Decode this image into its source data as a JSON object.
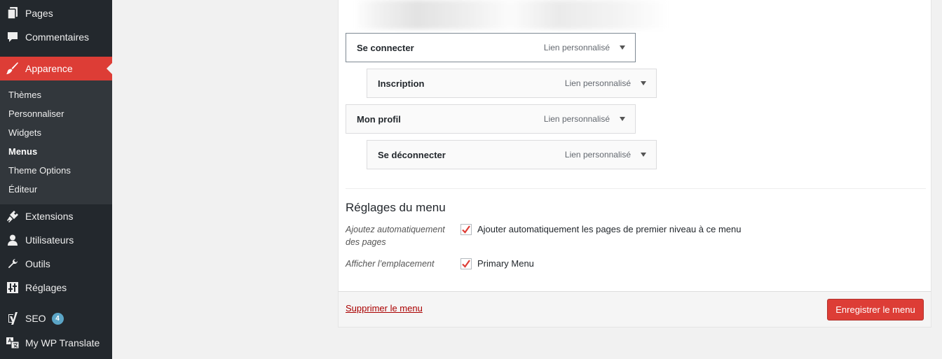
{
  "sidebar": {
    "top_items": [
      {
        "label": "Pages",
        "icon": "pages-icon"
      },
      {
        "label": "Commentaires",
        "icon": "comments-icon"
      },
      {
        "label": "Apparence",
        "icon": "paintbrush-icon",
        "active": true
      }
    ],
    "submenu": [
      {
        "label": "Thèmes"
      },
      {
        "label": "Personnaliser"
      },
      {
        "label": "Widgets"
      },
      {
        "label": "Menus",
        "current": true
      },
      {
        "label": "Theme Options"
      },
      {
        "label": "Éditeur"
      }
    ],
    "bottom_items": [
      {
        "label": "Extensions",
        "icon": "plugins-icon"
      },
      {
        "label": "Utilisateurs",
        "icon": "users-icon"
      },
      {
        "label": "Outils",
        "icon": "wrench-icon"
      },
      {
        "label": "Réglages",
        "icon": "settings-icon"
      },
      {
        "label": "SEO",
        "icon": "yoast-icon",
        "badge": "4"
      },
      {
        "label": "My WP Translate",
        "icon": "translate-icon"
      }
    ],
    "colors": {
      "background": "#23282d",
      "submenu_bg": "#32373c",
      "active": "#dd3d36",
      "badge": "#5ba5c6"
    }
  },
  "menu_structure": {
    "entries": [
      {
        "title": "Se connecter",
        "type": "Lien personnalisé",
        "depth": 0
      },
      {
        "title": "Inscription",
        "type": "Lien personnalisé",
        "depth": 1
      },
      {
        "title": "Mon profil",
        "type": "Lien personnalisé",
        "depth": 0
      },
      {
        "title": "Se déconnecter",
        "type": "Lien personnalisé",
        "depth": 1
      }
    ]
  },
  "menu_settings": {
    "title": "Réglages du menu",
    "auto_add": {
      "label": "Ajoutez automatiquement des pages",
      "option": "Ajouter automatiquement les pages de premier niveau à ce menu",
      "checked": true
    },
    "location": {
      "label": "Afficher l’emplacement",
      "option": "Primary Menu",
      "checked": true
    }
  },
  "footer": {
    "delete_label": "Supprimer le menu",
    "save_label": "Enregistrer le menu"
  }
}
